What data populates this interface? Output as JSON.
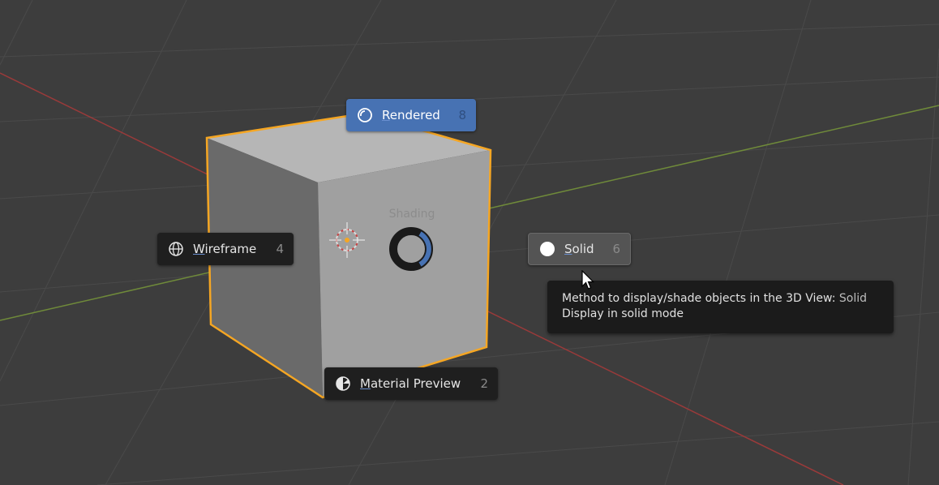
{
  "pie_menu": {
    "title": "Shading",
    "items": [
      {
        "label": "Rendered",
        "shortcut": "8",
        "icon": "rendered-sphere-icon",
        "active": true
      },
      {
        "label": "Wireframe",
        "shortcut": "4",
        "icon": "wireframe-globe-icon",
        "active": false
      },
      {
        "label": "Solid",
        "shortcut": "6",
        "icon": "solid-circle-icon",
        "active": false,
        "hovered": true
      },
      {
        "label": "Material Preview",
        "shortcut": "2",
        "icon": "material-preview-icon",
        "active": false
      }
    ]
  },
  "tooltip": {
    "description": "Method to display/shade objects in the 3D View:",
    "value": "Solid",
    "detail": "Display in solid mode"
  },
  "colors": {
    "background": "#3d3d3d",
    "active_item": "#4772b3",
    "selection_outline": "#f5a623",
    "x_axis": "#9a3a3a",
    "y_axis": "#6f8a3a"
  }
}
